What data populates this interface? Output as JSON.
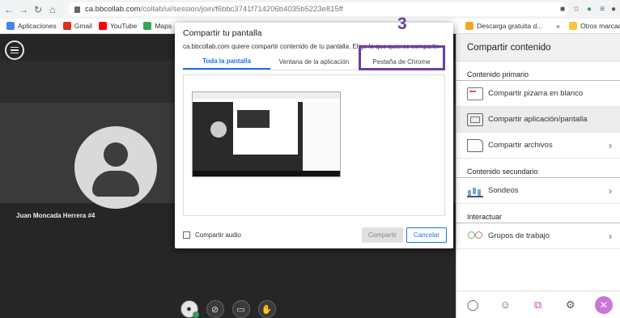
{
  "browser": {
    "url_host": "ca.bbcollab.com",
    "url_path": "/collab/ui/session/join/f6bbc3741f714206b4035b5223e815ff",
    "bookmarks": [
      {
        "label": "Aplicaciones",
        "icon": "apps-grid-icon",
        "color": "#4285f4"
      },
      {
        "label": "Gmail",
        "icon": "gmail-icon",
        "color": "#d93025"
      },
      {
        "label": "YouTube",
        "icon": "youtube-icon",
        "color": "#ff0000"
      },
      {
        "label": "Maps",
        "icon": "maps-icon",
        "color": "#34a853"
      }
    ],
    "bookmarks_right": [
      {
        "label": "Descarga gratuita d...",
        "icon": "bookmark-orange-icon",
        "color": "#f5a623"
      },
      {
        "label": "Otros marcadores",
        "icon": "folder-icon",
        "color": "#f6c343"
      }
    ],
    "bookmarks_overflow": "»"
  },
  "stage": {
    "participant_name": "Juan Moncada Herrera #4"
  },
  "dialog": {
    "title": "Compartir tu pantalla",
    "description": "ca.bbcollab.com quiere compartir contenido de tu pantalla. Elige lo que quieres compartir.",
    "tabs": [
      "Toda la pantalla",
      "Ventana de la aplicación",
      "Pestaña de Chrome"
    ],
    "active_tab": 0,
    "audio_label": "Compartir audio",
    "share_label": "Compartir",
    "cancel_label": "Cancelar"
  },
  "annotation": {
    "step_number": "3",
    "color": "#6f3fa0"
  },
  "panel": {
    "title": "Compartir contenido",
    "primary_heading": "Contenido primario",
    "primary_items": [
      {
        "label": "Compartir pizarra en blanco",
        "chevron": false
      },
      {
        "label": "Compartir aplicación/pantalla",
        "chevron": false,
        "active": true
      },
      {
        "label": "Compartir archivos",
        "chevron": true
      }
    ],
    "secondary_heading": "Contenido secundario",
    "secondary_items": [
      {
        "label": "Sondeos",
        "chevron": true
      }
    ],
    "interact_heading": "Interactuar",
    "interact_items": [
      {
        "label": "Grupos de trabajo",
        "chevron": true
      }
    ],
    "chevron_glyph": "›"
  },
  "colors": {
    "accent_blue": "#1a73e8",
    "collab_purple": "#c877d6",
    "stage_bg": "#262626"
  }
}
